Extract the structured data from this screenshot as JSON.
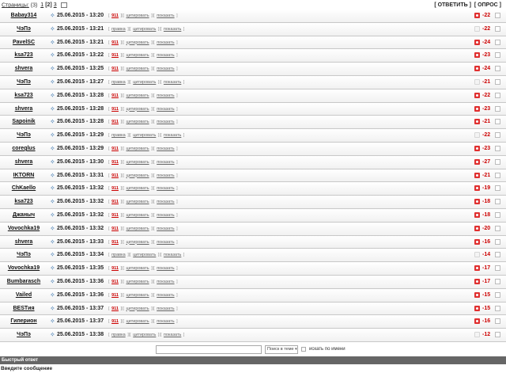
{
  "pagination": {
    "label": "Страницы:",
    "total": "(3)",
    "pages": [
      {
        "text": "1",
        "current": false
      },
      {
        "text": "[2]",
        "current": true
      },
      {
        "text": "3",
        "current": false
      }
    ],
    "pager_icon": "pages-menu-icon"
  },
  "top_actions": {
    "reply": "[ ОТВЕТИТЬ ]",
    "poll": "[ ОПРОС ]"
  },
  "row_buttons": {
    "b1": "911",
    "b1_alt": "правка",
    "b2": "цитировать",
    "b3": "показать",
    "bracket_open": "[",
    "bracket_close": "]",
    "separator": "|"
  },
  "posts": [
    {
      "author": "Babay314",
      "date": "25.06.2015 - 13:20",
      "variant": "911",
      "rated": true,
      "score": "-22"
    },
    {
      "author": "ЧэПэ",
      "date": "25.06.2015 - 13:21",
      "variant": "правка",
      "rated": false,
      "score": "-22"
    },
    {
      "author": "PavelSC",
      "date": "25.06.2015 - 13:21",
      "variant": "911",
      "rated": true,
      "score": "-24"
    },
    {
      "author": "ksa723",
      "date": "25.06.2015 - 13:22",
      "variant": "911",
      "rated": true,
      "score": "-23"
    },
    {
      "author": "shvera",
      "date": "25.06.2015 - 13:25",
      "variant": "911",
      "rated": true,
      "score": "-24"
    },
    {
      "author": "ЧэПэ",
      "date": "25.06.2015 - 13:27",
      "variant": "правка",
      "rated": false,
      "score": "-21"
    },
    {
      "author": "ksa723",
      "date": "25.06.2015 - 13:28",
      "variant": "911",
      "rated": true,
      "score": "-22"
    },
    {
      "author": "shvera",
      "date": "25.06.2015 - 13:28",
      "variant": "911",
      "rated": true,
      "score": "-23"
    },
    {
      "author": "Sapoinik",
      "date": "25.06.2015 - 13:28",
      "variant": "911",
      "rated": true,
      "score": "-21"
    },
    {
      "author": "ЧэПэ",
      "date": "25.06.2015 - 13:29",
      "variant": "правка",
      "rated": false,
      "score": "-22"
    },
    {
      "author": "coreglus",
      "date": "25.06.2015 - 13:29",
      "variant": "911",
      "rated": true,
      "score": "-23"
    },
    {
      "author": "shvera",
      "date": "25.06.2015 - 13:30",
      "variant": "911",
      "rated": true,
      "score": "-27"
    },
    {
      "author": "IKTORN",
      "date": "25.06.2015 - 13:31",
      "variant": "911",
      "rated": true,
      "score": "-21"
    },
    {
      "author": "ChKaello",
      "date": "25.06.2015 - 13:32",
      "variant": "911",
      "rated": true,
      "score": "-19"
    },
    {
      "author": "ksa723",
      "date": "25.06.2015 - 13:32",
      "variant": "911",
      "rated": true,
      "score": "-18"
    },
    {
      "author": "Джаныч",
      "date": "25.06.2015 - 13:32",
      "variant": "911",
      "rated": true,
      "score": "-18"
    },
    {
      "author": "Vovochka19",
      "date": "25.06.2015 - 13:32",
      "variant": "911",
      "rated": true,
      "score": "-20"
    },
    {
      "author": "shvera",
      "date": "25.06.2015 - 13:33",
      "variant": "911",
      "rated": true,
      "score": "-16"
    },
    {
      "author": "ЧэПэ",
      "date": "25.06.2015 - 13:34",
      "variant": "правка",
      "rated": false,
      "score": "-14"
    },
    {
      "author": "Vovochka19",
      "date": "25.06.2015 - 13:35",
      "variant": "911",
      "rated": true,
      "score": "-17"
    },
    {
      "author": "Bumbarasch",
      "date": "25.06.2015 - 13:36",
      "variant": "911",
      "rated": true,
      "score": "-17"
    },
    {
      "author": "Vailed",
      "date": "25.06.2015 - 13:36",
      "variant": "911",
      "rated": true,
      "score": "-15"
    },
    {
      "author": "BESTия",
      "date": "25.06.2015 - 13:37",
      "variant": "911",
      "rated": true,
      "score": "-15"
    },
    {
      "author": "Гиперион",
      "date": "25.06.2015 - 13:37",
      "variant": "911",
      "rated": true,
      "score": "-16"
    },
    {
      "author": "ЧэПэ",
      "date": "25.06.2015 - 13:38",
      "variant": "правка",
      "rated": false,
      "score": "-12"
    }
  ],
  "search": {
    "input_value": "",
    "select_value": "Поиск в теме",
    "checkbox_label": "искать по имени"
  },
  "quick_reply": {
    "title": "Быстрый ответ"
  },
  "compose": {
    "label": "Введите сообщение"
  },
  "colors": {
    "score_negative": "#cc0000",
    "rate_active": "#e03030",
    "quick_bar": "#666666",
    "pin_icon": "#2a6aa8"
  },
  "icons": {
    "post_pin": "pin-icon",
    "rate": "rating-icon",
    "select_arrow": "chevron-down-icon"
  }
}
